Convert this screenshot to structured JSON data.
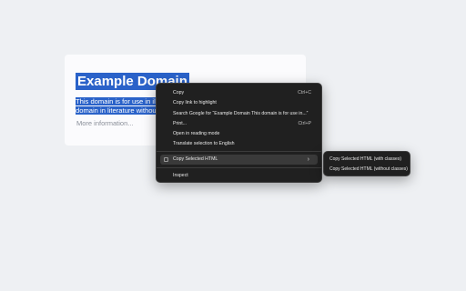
{
  "page": {
    "title": "Example Domain",
    "body_line1": "This domain is for use in illustra",
    "body_line2": "domain in literature without pr",
    "more_link": "More information..."
  },
  "context_menu": {
    "items": [
      {
        "label": "Copy",
        "shortcut": "Ctrl+C"
      },
      {
        "label": "Copy link to highlight",
        "shortcut": ""
      },
      {
        "label": "Search Google for “Example Domain This domain is for use in...”",
        "shortcut": ""
      },
      {
        "label": "Print...",
        "shortcut": "Ctrl+P"
      },
      {
        "label": "Open in reading mode",
        "shortcut": ""
      },
      {
        "label": "Translate selection to English",
        "shortcut": ""
      }
    ],
    "extension_item": {
      "label": "Copy Selected HTML",
      "icon": "extension-icon"
    },
    "inspect": "Inspect"
  },
  "submenu": {
    "items": [
      "Copy Selected HTML (with classes)",
      "Copy Selected HTML (without classes)"
    ]
  },
  "colors": {
    "selection": "#2a62c9",
    "menu_bg": "#202020",
    "page_bg": "#eef0f3"
  }
}
